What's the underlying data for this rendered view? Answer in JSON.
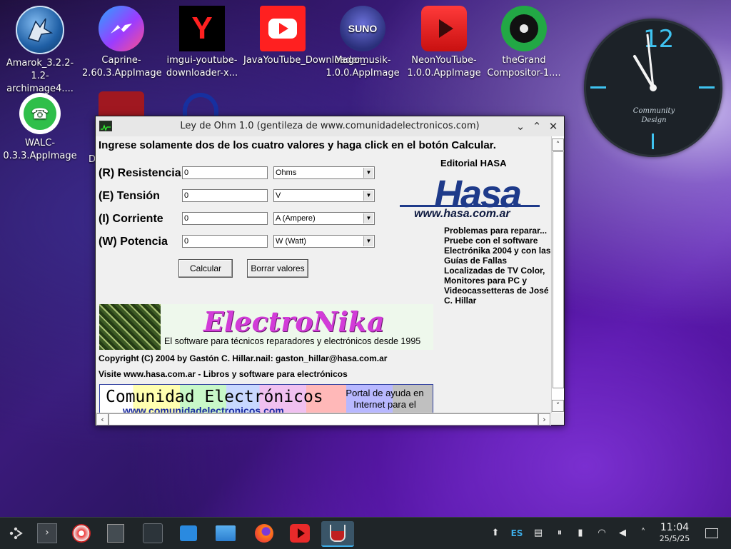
{
  "desktop": {
    "icons": [
      {
        "label": "Amarok_3.2.2-1.2-archimage4....",
        "icon": "amarok-wolf-icon",
        "color": "#1f6fb5"
      },
      {
        "label": "Caprine-2.60.3.AppImage",
        "icon": "messenger-icon",
        "color": "#7c4dff"
      },
      {
        "label": "imgui-youtube-downloader-x...",
        "icon": "yandex-y-icon",
        "color": "#000000"
      },
      {
        "label": "JavaYouTube_Downloader_...",
        "icon": "youtube-play-icon",
        "color": "#ff2020"
      },
      {
        "label": "Magomusik-1.0.0.AppImage",
        "icon": "suno-icon",
        "color": "#2a2f7a"
      },
      {
        "label": "NeonYouTube-1.0.0.AppImage",
        "icon": "youtube-play-icon",
        "color": "#e82a2a"
      },
      {
        "label": "theGrand Compositor-1....",
        "icon": "vinyl-record-icon",
        "color": "#22a845"
      },
      {
        "label": "WALC-0.3.3.AppImage",
        "icon": "whatsapp-icon",
        "color": "#2fbf4a"
      }
    ],
    "partial_label": "D",
    "suno_text": "SUNO",
    "yandex_text": "Y"
  },
  "clock": {
    "hour_label": "12",
    "brand_line1": "Community",
    "brand_line2": "Design",
    "time": "11:04"
  },
  "window": {
    "title": "Ley de Ohm 1.0 (gentileza de www.comunidadelectronicos.com)",
    "heading": "Ingrese solamente dos de los cuatro valores y haga click en el botón Calcular.",
    "fields": [
      {
        "label": "(R) Resistencia",
        "value": "0",
        "unit": "Ohms"
      },
      {
        "label": "(E) Tensión",
        "value": "0",
        "unit": "V"
      },
      {
        "label": "(I) Corriente",
        "value": "0",
        "unit": "A (Ampere)"
      },
      {
        "label": "(W) Potencia",
        "value": "0",
        "unit": "W (Watt)"
      }
    ],
    "calc_button": "Calcular",
    "clear_button": "Borrar valores",
    "editorial": "Editorial HASA",
    "hasa_logo": "Hasa",
    "hasa_url": "www.hasa.com.ar",
    "side_text": "Problemas para reparar... Pruebe con el software Electrónika 2004 y con las Guías de Fallas Localizadas de TV Color, Monitores para PC y Videocassetteras de José C. Hillar",
    "banner_brand": "ElectroNika",
    "banner_tagline": "El software para técnicos reparadores y electrónicos desde 1995",
    "copyright": "Copyright (C) 2004 by Gastón C. Hillar.nail: gaston_hillar@hasa.com.ar",
    "visite": "Visite www.hasa.com.ar - Libros y software para electrónicos",
    "community_name": "Comunidad Electrónicos",
    "community_url": "www.comunidadelectronicos.com",
    "community_portal": "Portal de ayuda en Internet para el"
  },
  "taskbar": {
    "apps": [
      "app-launcher-icon",
      "terminal-icon",
      "media-player-icon",
      "calculator-icon",
      "settings-sliders-icon",
      "store-icon",
      "file-manager-icon",
      "firefox-icon",
      "youtube-player-icon",
      "ohm-law-app-icon"
    ],
    "lang": "ES",
    "time": "11:04",
    "date": "25/5/25"
  }
}
